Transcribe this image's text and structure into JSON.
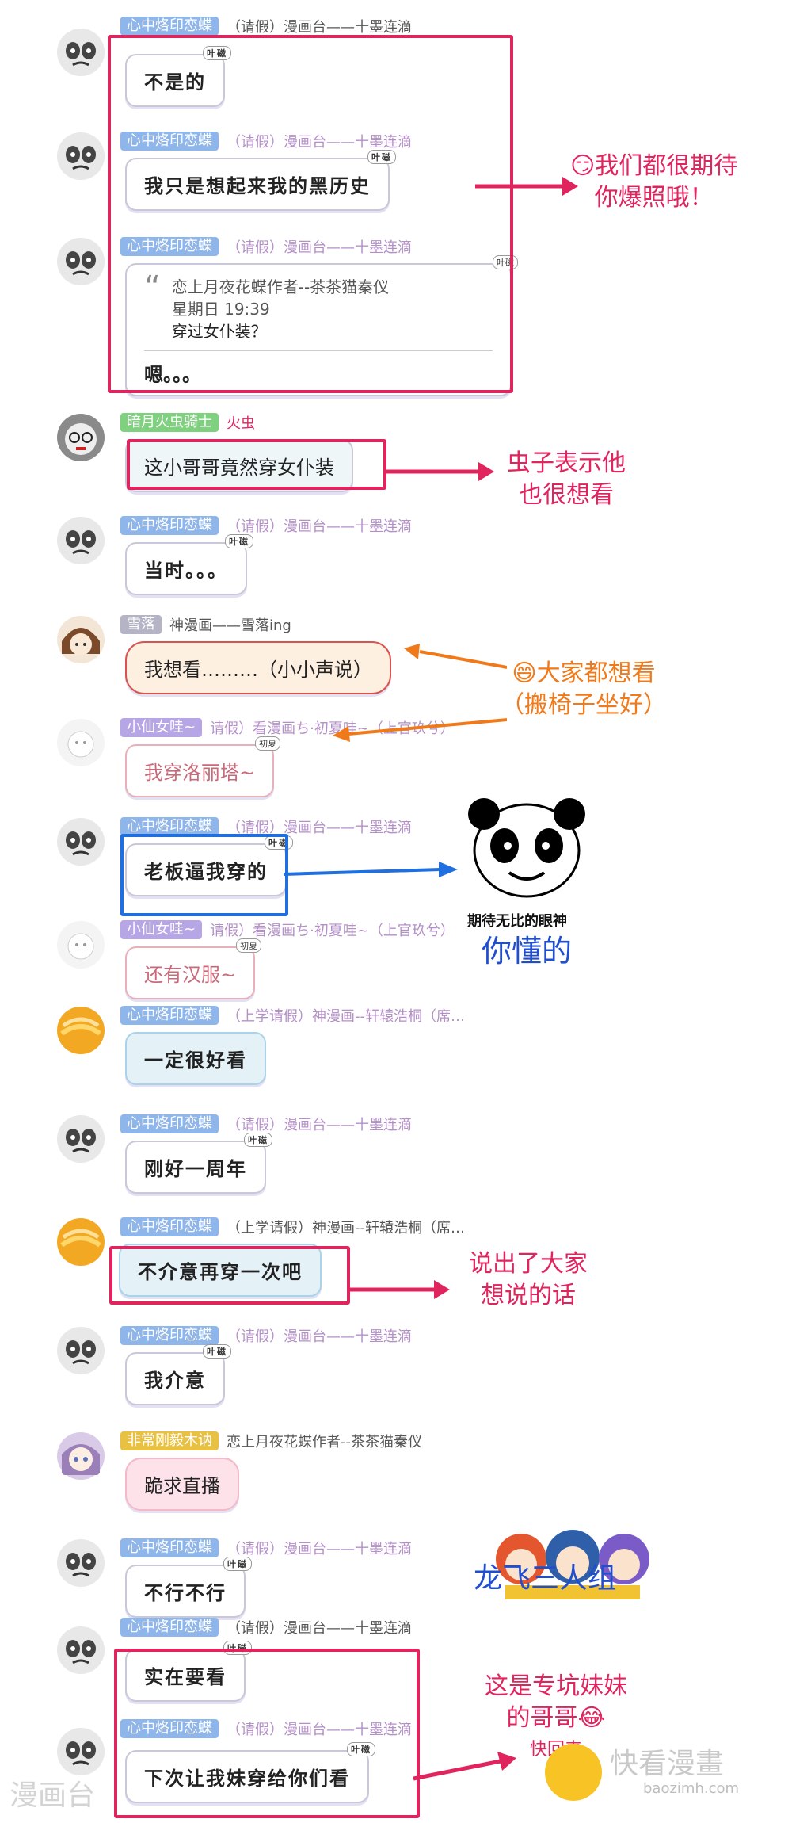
{
  "messages": [
    {
      "name": "心中烙印恋蝶",
      "tag": "blue",
      "group": "（请假）漫画台——十墨连滴",
      "text": "不是的",
      "badge": "叶磁",
      "hand": true
    },
    {
      "name": "心中烙印恋蝶",
      "tag": "blue",
      "group": "（请假）漫画台——十墨连滴",
      "text": "我只是想起来我的黑历史",
      "badge": "叶磁",
      "hand": true
    },
    {
      "name": "心中烙印恋蝶",
      "tag": "blue",
      "group": "（请假）漫画台——十墨连滴",
      "quote_author": "恋上月夜花蝶作者--茶茶猫秦仪",
      "quote_time": "星期日 19:39",
      "quote_text": "穿过女仆装？",
      "text": "嗯。。。",
      "badge": "叶磁"
    },
    {
      "name": "暗月火虫骑士",
      "tag": "green",
      "group": "火虫",
      "text": "这小哥哥竟然穿女仆装"
    },
    {
      "name": "心中烙印恋蝶",
      "tag": "blue",
      "group": "（请假）漫画台——十墨连滴",
      "text": "当时。。。",
      "badge": "叶磁",
      "hand": true
    },
    {
      "name": "雪落",
      "tag": "grey",
      "group": "神漫画——雪落ing",
      "text": "我想看………（小小声说）"
    },
    {
      "name": "小仙女哇~",
      "tag": "purple",
      "group": "请假）看漫画ち·初夏哇~（上官玖兮）",
      "text": "我穿洛丽塔~",
      "badge": "初夏"
    },
    {
      "name": "心中烙印恋蝶",
      "tag": "blue",
      "group": "（请假）漫画台——十墨连滴",
      "text": "老板逼我穿的",
      "badge": "叶磁",
      "hand": true
    },
    {
      "name": "小仙女哇~",
      "tag": "purple",
      "group": "请假）看漫画ち·初夏哇~（上官玖兮）",
      "text": "还有汉服~",
      "badge": "初夏"
    },
    {
      "name": "心中烙印恋蝶",
      "tag": "blue",
      "group": "（上学请假）神漫画--轩辕浩桐（席…",
      "text": "一定很好看",
      "hand": true
    },
    {
      "name": "心中烙印恋蝶",
      "tag": "blue",
      "group": "（请假）漫画台——十墨连滴",
      "text": "刚好一周年",
      "badge": "叶磁",
      "hand": true
    },
    {
      "name": "心中烙印恋蝶",
      "tag": "blue",
      "group": "（上学请假）神漫画--轩辕浩桐（席…",
      "text": "不介意再穿一次吧",
      "hand": true
    },
    {
      "name": "心中烙印恋蝶",
      "tag": "blue",
      "group": "（请假）漫画台——十墨连滴",
      "text": "我介意",
      "badge": "叶磁",
      "hand": true
    },
    {
      "name": "非常刚毅木讷",
      "tag": "gold",
      "group": "恋上月夜花蝶作者--茶茶猫秦仪",
      "text": "跪求直播"
    },
    {
      "name": "心中烙印恋蝶",
      "tag": "blue",
      "group": "（请假）漫画台——十墨连滴",
      "text": "不行不行",
      "badge": "叶磁",
      "hand": true
    },
    {
      "name": "心中烙印恋蝶",
      "tag": "blue",
      "group": "（请假）漫画台——十墨连滴",
      "text": "实在要看",
      "badge": "叶磁",
      "hand": true
    },
    {
      "name": "心中烙印恋蝶",
      "tag": "blue",
      "group": "（请假）漫画台——十墨连滴",
      "text": "下次让我妹穿给你们看",
      "badge": "叶磁",
      "hand": true
    }
  ],
  "notes": {
    "n1_line1": "我们都很期待",
    "n1_line2": "你爆照哦！",
    "n2_line1": "虫子表示他",
    "n2_line2": "也很想看",
    "n3_line1": "大家都想看",
    "n3_line2": "（搬椅子坐好）",
    "n4": "你懂的",
    "n5_line1": "说出了大家",
    "n5_line2": "想说的话",
    "n6": "龙飞三人组",
    "n7_line1": "这是专坑妹妹",
    "n7_line2": "的哥哥",
    "n7_line3": "快回来",
    "panda_caption": "期待无比的眼神"
  },
  "watermarks": {
    "left": "漫画台",
    "right": "快看漫畫",
    "right_url": "baozimh.com"
  },
  "colors": {
    "frame_red": "#e0245e",
    "frame_blue": "#1f6fe0",
    "note_orange": "#f07a1a"
  }
}
